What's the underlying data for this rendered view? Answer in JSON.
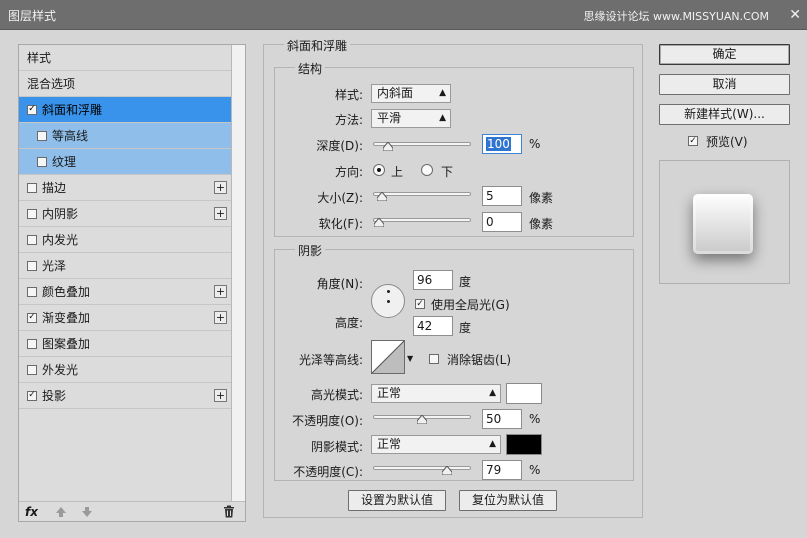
{
  "window": {
    "title": "图层样式",
    "watermark": "思缘设计论坛 www.MISSYUAN.COM",
    "close": "✕"
  },
  "sidebar": {
    "items": [
      {
        "label": "样式",
        "checkbox": false,
        "checked": false,
        "plus": false,
        "state": "normal"
      },
      {
        "label": "混合选项",
        "checkbox": false,
        "checked": false,
        "plus": false,
        "state": "normal"
      },
      {
        "label": "斜面和浮雕",
        "checkbox": true,
        "checked": true,
        "plus": false,
        "state": "selected"
      },
      {
        "label": "等高线",
        "checkbox": true,
        "checked": false,
        "plus": false,
        "state": "sub"
      },
      {
        "label": "纹理",
        "checkbox": true,
        "checked": false,
        "plus": false,
        "state": "sub"
      },
      {
        "label": "描边",
        "checkbox": true,
        "checked": false,
        "plus": true,
        "state": "normal"
      },
      {
        "label": "内阴影",
        "checkbox": true,
        "checked": false,
        "plus": true,
        "state": "normal"
      },
      {
        "label": "内发光",
        "checkbox": true,
        "checked": false,
        "plus": false,
        "state": "normal"
      },
      {
        "label": "光泽",
        "checkbox": true,
        "checked": false,
        "plus": false,
        "state": "normal"
      },
      {
        "label": "颜色叠加",
        "checkbox": true,
        "checked": false,
        "plus": true,
        "state": "normal"
      },
      {
        "label": "渐变叠加",
        "checkbox": true,
        "checked": true,
        "plus": true,
        "state": "normal"
      },
      {
        "label": "图案叠加",
        "checkbox": true,
        "checked": false,
        "plus": false,
        "state": "normal"
      },
      {
        "label": "外发光",
        "checkbox": true,
        "checked": false,
        "plus": false,
        "state": "normal"
      },
      {
        "label": "投影",
        "checkbox": true,
        "checked": true,
        "plus": true,
        "state": "normal"
      }
    ],
    "fx_label": "fx",
    "icons": {
      "up": "arrow-up-icon",
      "down": "arrow-down-icon",
      "trash": "trash-icon"
    }
  },
  "bevel": {
    "section_title": "斜面和浮雕",
    "structure": {
      "title": "结构",
      "style_label": "样式:",
      "style_value": "内斜面",
      "method_label": "方法:",
      "method_value": "平滑",
      "depth_label": "深度(D):",
      "depth_value": "100",
      "depth_unit": "%",
      "depth_fraction": 0.1,
      "direction_label": "方向:",
      "direction_up": "上",
      "direction_down": "下",
      "direction_selected": "up",
      "size_label": "大小(Z):",
      "size_value": "5",
      "size_unit": "像素",
      "size_fraction": 0.04,
      "soften_label": "软化(F):",
      "soften_value": "0",
      "soften_unit": "像素",
      "soften_fraction": 0.0
    },
    "shading": {
      "title": "阴影",
      "angle_label": "角度(N):",
      "angle_value": "96",
      "angle_unit": "度",
      "global_light_label": "使用全局光(G)",
      "global_light_checked": true,
      "altitude_label": "高度:",
      "altitude_value": "42",
      "altitude_unit": "度",
      "gloss_label": "光泽等高线:",
      "antialias_label": "消除锯齿(L)",
      "antialias_checked": false,
      "highlight_mode_label": "高光模式:",
      "highlight_mode_value": "正常",
      "highlight_color": "#ffffff",
      "highlight_opacity_label": "不透明度(O):",
      "highlight_opacity_value": "50",
      "highlight_opacity_unit": "%",
      "highlight_opacity_fraction": 0.5,
      "shadow_mode_label": "阴影模式:",
      "shadow_mode_value": "正常",
      "shadow_color": "#000000",
      "shadow_opacity_label": "不透明度(C):",
      "shadow_opacity_value": "79",
      "shadow_opacity_unit": "%",
      "shadow_opacity_fraction": 0.79
    },
    "make_default": "设置为默认值",
    "reset_default": "复位为默认值"
  },
  "actions": {
    "ok": "确定",
    "cancel": "取消",
    "new_style": "新建样式(W)...",
    "preview_label": "预览(V)",
    "preview_checked": true
  }
}
